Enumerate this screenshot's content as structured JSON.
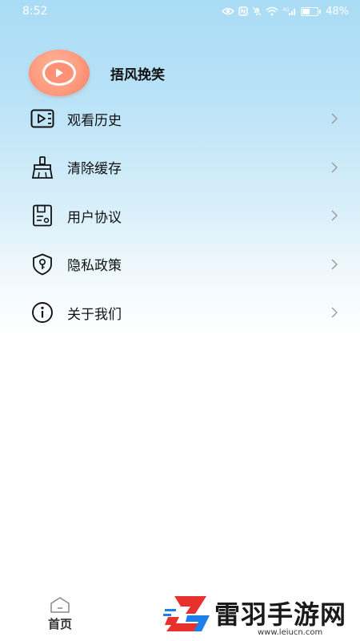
{
  "status_bar": {
    "time": "8:52",
    "battery": "48%",
    "signal_text": "⁴ᴳ"
  },
  "profile": {
    "username": "捂风挽笑",
    "avatar_icon": "play-icon"
  },
  "menu": {
    "items": [
      {
        "label": "观看历史",
        "icon": "video-history-icon"
      },
      {
        "label": "清除缓存",
        "icon": "broom-icon"
      },
      {
        "label": "用户协议",
        "icon": "document-icon"
      },
      {
        "label": "隐私政策",
        "icon": "shield-key-icon"
      },
      {
        "label": "关于我们",
        "icon": "info-icon"
      }
    ]
  },
  "tab_bar": {
    "home_label": "首页"
  },
  "watermark": {
    "title": "雷羽手游网",
    "url": "www.leiucn.com"
  },
  "colors": {
    "bg_top": "#a9dcf5",
    "avatar": "#ff9b7e",
    "watermark_red": "#e8312c",
    "watermark_blue": "#1f7fe8"
  }
}
